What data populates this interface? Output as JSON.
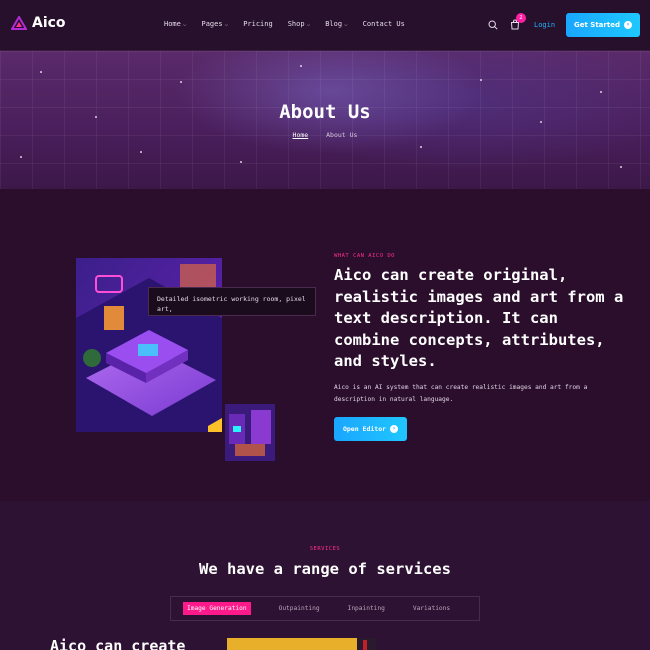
{
  "nav": {
    "logo_text": "Aico",
    "menu": [
      {
        "label": "Home",
        "has_dropdown": true
      },
      {
        "label": "Pages",
        "has_dropdown": true
      },
      {
        "label": "Pricing",
        "has_dropdown": false
      },
      {
        "label": "Shop",
        "has_dropdown": true
      },
      {
        "label": "Blog",
        "has_dropdown": true
      },
      {
        "label": "Contact Us",
        "has_dropdown": false
      }
    ],
    "cart_count": "2",
    "login_label": "Login",
    "cta_label": "Get Started"
  },
  "hero": {
    "title": "About Us",
    "breadcrumb": [
      "Home",
      "About Us"
    ]
  },
  "about": {
    "prompt_text": "Detailed isometric working room, pixel art,",
    "eyebrow": "WHAT CAN AICO DO",
    "heading": "Aico can create original, realistic images and art from a text description. It can combine concepts, attributes, and styles.",
    "description": "Aico is an AI system that can create realistic images and art from a description in natural language.",
    "button_label": "Open Editor"
  },
  "services": {
    "eyebrow": "SERVICES",
    "heading": "We have a range of services",
    "tabs": [
      "Image Generation",
      "Outpainting",
      "Inpainting",
      "Variations"
    ],
    "active_tab": "Image Generation",
    "partial_heading": "Aico can create"
  },
  "colors": {
    "accent_blue": "#1aa6ff",
    "accent_pink": "#ff1a8c",
    "background": "#2a0e2c"
  }
}
